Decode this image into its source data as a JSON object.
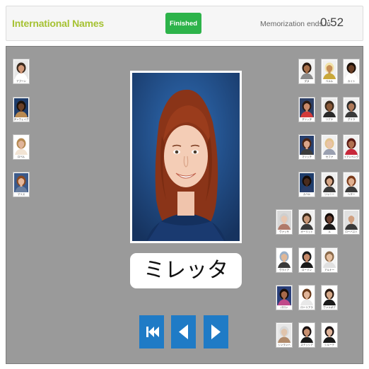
{
  "header": {
    "title": "International Names",
    "finished_label": "Finished",
    "timer_label": "Memorization ends in",
    "timer_value": "0:52"
  },
  "main_card": {
    "name": "ミレッタ"
  },
  "thumbnails": [
    {
      "name": "アブーン",
      "skin": "#d39a7a",
      "hair": "#3a2a1e",
      "shirt": "#ffffff",
      "bg": "#e8e8e8"
    },
    {
      "name": "タンウェイグ",
      "skin": "#6b4128",
      "hair": "#1d120b",
      "shirt": "#b98a52",
      "bg": "#1f3d6b"
    },
    {
      "name": "ロベル",
      "skin": "#e0b49a",
      "hair": "#b58a52",
      "shirt": "#f2e4d4",
      "bg": "#ffffff"
    },
    {
      "name": "マリス",
      "skin": "#e5b89c",
      "hair": "#8a4a22",
      "shirt": "#6a7fa0",
      "bg": "#3b5a8b"
    },
    {
      "name": "ダヌ",
      "skin": "#a8704a",
      "hair": "#2a1a10",
      "shirt": "#8a8a8a",
      "bg": "#f0f0f0"
    },
    {
      "name": "ベルル",
      "skin": "#c79058",
      "hair": "#f2e2a8",
      "shirt": "#c9a83a",
      "bg": "#f0f0f0"
    },
    {
      "name": "カイト",
      "skin": "#6a3f26",
      "hair": "#1a0f08",
      "shirt": "#ffffff",
      "bg": "#f5f5f5"
    },
    {
      "name": "ダリッタ",
      "skin": "#c98a6a",
      "hair": "#2a1a12",
      "shirt": "#d23a3a",
      "bg": "#2c3f66"
    },
    {
      "name": "リアナ",
      "skin": "#8a5a3a",
      "hair": "#3a2a1c",
      "shirt": "#2a2a2a",
      "bg": "#ececec"
    },
    {
      "name": "グリラ",
      "skin": "#b07a5a",
      "hair": "#2a2a2a",
      "shirt": "#3a3a3a",
      "bg": "#f0f0f0"
    },
    {
      "name": "マリッチ",
      "skin": "#d9a58a",
      "hair": "#4a2414",
      "shirt": "#3c3c3c",
      "bg": "#28406e"
    },
    {
      "name": "セファ",
      "skin": "#e9c4a8",
      "hair": "#e3c38e",
      "shirt": "#9aa0b0",
      "bg": "#f0f0f0"
    },
    {
      "name": "イアンペング",
      "skin": "#b07050",
      "hair": "#5a1a14",
      "shirt": "#c7283a",
      "bg": "#f0f0f0"
    },
    {
      "name": "カベル",
      "skin": "#4a2c1e",
      "hair": "#140a06",
      "shirt": "#2a3e6a",
      "bg": "#1f3d6b"
    },
    {
      "name": "リャニー",
      "skin": "#d6a686",
      "hair": "#2a1a10",
      "shirt": "#3a3a3a",
      "bg": "#f0f0f0"
    },
    {
      "name": "ヘザー",
      "skin": "#e0b090",
      "hair": "#7a3a1a",
      "shirt": "#3a3a3a",
      "bg": "#f0f0f0"
    },
    {
      "name": "ヴァッサ",
      "skin": "#e8c6b0",
      "hair": "#cfcfcf",
      "shirt": "#b07a6a",
      "bg": "#d8d8d8"
    },
    {
      "name": "オーリット",
      "skin": "#c89878",
      "hair": "#3a2a1a",
      "shirt": "#3a3a3a",
      "bg": "#f0f0f0"
    },
    {
      "name": "ル",
      "skin": "#6a4030",
      "hair": "#120a06",
      "shirt": "#1a1a1a",
      "bg": "#f5f5f5"
    },
    {
      "name": "ローバスト",
      "skin": "#d0a080",
      "hair": "#e2e2e2",
      "shirt": "#3a3a3a",
      "bg": "#e0e0e0"
    },
    {
      "name": "ヴライア",
      "skin": "#e0b898",
      "hair": "#9ab0c8",
      "shirt": "#3a3a3a",
      "bg": "#ffffff"
    },
    {
      "name": "ロードン",
      "skin": "#c68a6a",
      "hair": "#1a1a1a",
      "shirt": "#1a1a1a",
      "bg": "#ffffff"
    },
    {
      "name": "アルナー",
      "skin": "#e6c0a0",
      "hair": "#8a6a4a",
      "shirt": "#e0e0e0",
      "bg": "#f5f5f5"
    },
    {
      "name": "パロン",
      "skin": "#a86a4a",
      "hair": "#1a0f08",
      "shirt": "#c04a8a",
      "bg": "#2a3f7a"
    },
    {
      "name": "ローリアラ",
      "skin": "#e0b498",
      "hair": "#6a3a1a",
      "shirt": "#e8e8e8",
      "bg": "#ffffff"
    },
    {
      "name": "ヴァルボア",
      "skin": "#d6a888",
      "hair": "#2a1a12",
      "shirt": "#1a1a1a",
      "bg": "#ffffff"
    },
    {
      "name": "シンランハ",
      "skin": "#e0c4ac",
      "hair": "#d8d8d8",
      "shirt": "#b08a6a",
      "bg": "#e8e8e8"
    },
    {
      "name": "ステッシア",
      "skin": "#c89070",
      "hair": "#1a1212",
      "shirt": "#1a1a1a",
      "bg": "#ffffff"
    },
    {
      "name": "シルーテ",
      "skin": "#e0b49a",
      "hair": "#1a1212",
      "shirt": "#1a1a1a",
      "bg": "#ffffff"
    }
  ],
  "controls": {
    "first_icon": "skip-to-first-icon",
    "prev_icon": "previous-icon",
    "next_icon": "next-icon",
    "accent": "#1f7bc6"
  },
  "colors": {
    "title": "#a6c233",
    "finished_button": "#2db34a",
    "board": "#9a9a9a"
  }
}
